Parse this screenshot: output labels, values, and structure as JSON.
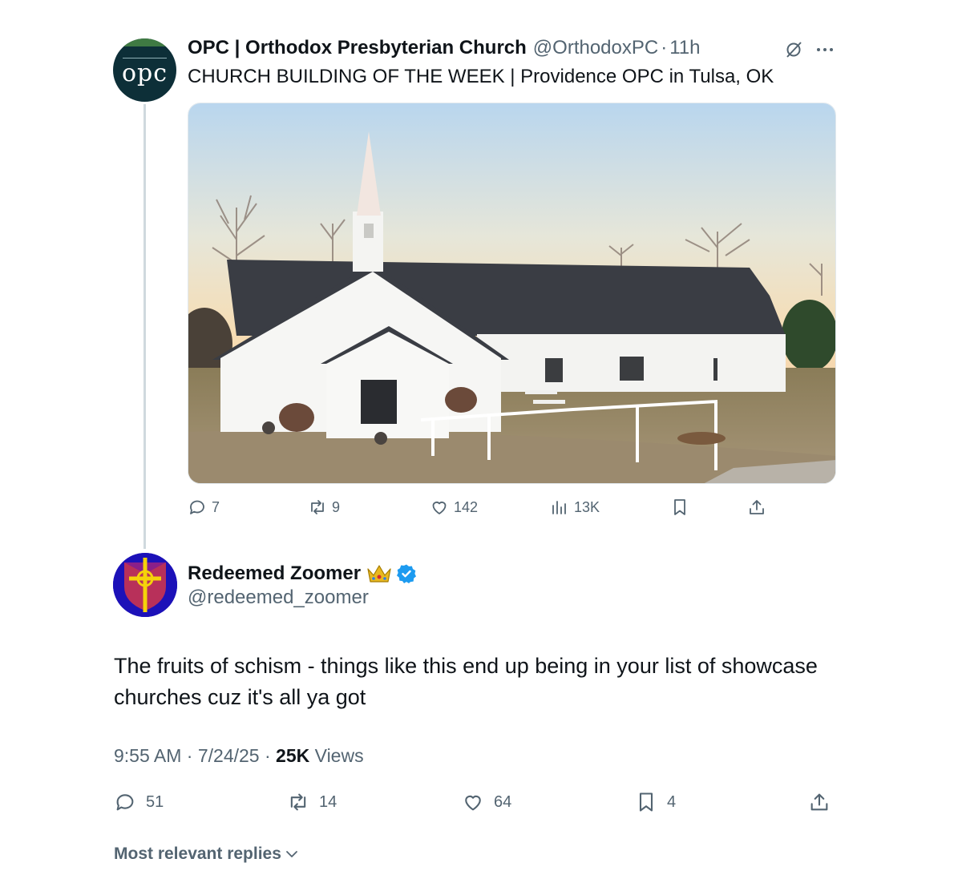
{
  "colors": {
    "text_primary": "#0f1419",
    "text_secondary": "#536471",
    "thread_line": "#cfd9de",
    "verified_blue": "#1d9bf0"
  },
  "parent_tweet": {
    "display_name": "OPC | Orthodox Presbyterian Church",
    "handle": "@OrthodoxPC",
    "separator": "·",
    "time": "11h",
    "avatar_text": "opc",
    "text": "CHURCH BUILDING OF THE WEEK | Providence OPC in Tulsa, OK",
    "media_description": "photo-white-church-building",
    "actions": {
      "replies": "7",
      "reposts": "9",
      "likes": "142",
      "views": "13K"
    },
    "icons": [
      "grok-icon",
      "more-icon",
      "reply-icon",
      "repost-icon",
      "like-icon",
      "views-icon",
      "bookmark-icon",
      "share-icon"
    ]
  },
  "main_tweet": {
    "display_name": "Redeemed Zoomer",
    "handle": "@redeemed_zoomer",
    "badges": [
      "crown-icon",
      "verified-icon"
    ],
    "text": "The fruits of schism - things like this end up being in your list of showcase churches cuz it's all ya got",
    "meta": {
      "time": "9:55 AM",
      "date": "7/24/25",
      "views_count": "25K",
      "views_label": "Views",
      "separator": "·"
    },
    "actions": {
      "replies": "51",
      "reposts": "14",
      "likes": "64",
      "bookmarks": "4"
    }
  },
  "replies_sort": {
    "label": "Most relevant replies"
  }
}
